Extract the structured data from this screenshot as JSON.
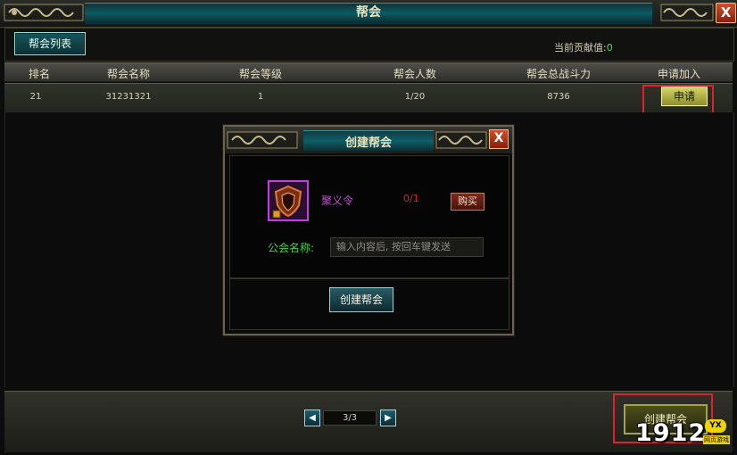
{
  "window": {
    "title": "帮会",
    "close_symbol": "X"
  },
  "tabs": [
    {
      "label": "帮会列表",
      "active": true
    }
  ],
  "contribution": {
    "label": "当前贡献值:",
    "value": "0"
  },
  "table": {
    "columns": [
      "排名",
      "帮会名称",
      "帮会等级",
      "帮会人数",
      "帮会总战斗力",
      "申请加入"
    ],
    "rows": [
      {
        "rank": "21",
        "name": "31231321",
        "level": "1",
        "members": "1/20",
        "power": "8736",
        "action": "申请"
      }
    ]
  },
  "pagination": {
    "prev_symbol": "◀",
    "next_symbol": "▶",
    "text": "3/3"
  },
  "footer": {
    "create_label": "创建帮会"
  },
  "dialog": {
    "title": "创建帮会",
    "close_symbol": "X",
    "item_name": "聚义令",
    "item_count": "0/1",
    "buy_label": "购买",
    "name_label": "公会名称:",
    "name_placeholder": "输入内容后, 按回车键发送",
    "create_label": "创建帮会"
  },
  "watermark": {
    "number": "1912",
    "badge": "YX",
    "sub": "网页游戏"
  },
  "colors": {
    "highlight": "#e0202a",
    "green_text": "#3ed53a",
    "item_purple": "#c64ad8",
    "count_red": "#d02a1e"
  }
}
